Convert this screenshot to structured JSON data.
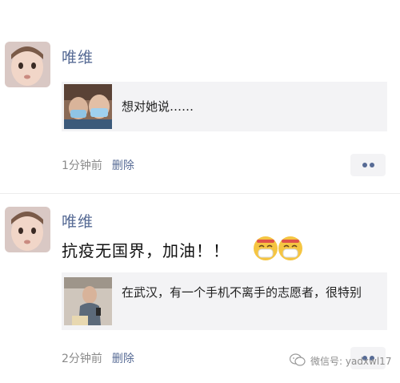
{
  "posts": [
    {
      "user": "唯维",
      "share_title": "想对她说……",
      "time": "1分钟前",
      "delete_label": "删除"
    },
    {
      "user": "唯维",
      "text": "抗疫无国界，加油！！",
      "share_title": "在武汉，有一个手机不离手的志愿者，很特别",
      "time": "2分钟前",
      "delete_label": "删除"
    }
  ],
  "watermark": "微信号: yadxwl17",
  "colors": {
    "username": "#576b95",
    "meta": "#8a8a8a",
    "card_bg": "#f3f3f5"
  },
  "icons": [
    "avatar-child",
    "mask-face-emoji",
    "more-dots-icon",
    "wechat-logo-icon"
  ]
}
